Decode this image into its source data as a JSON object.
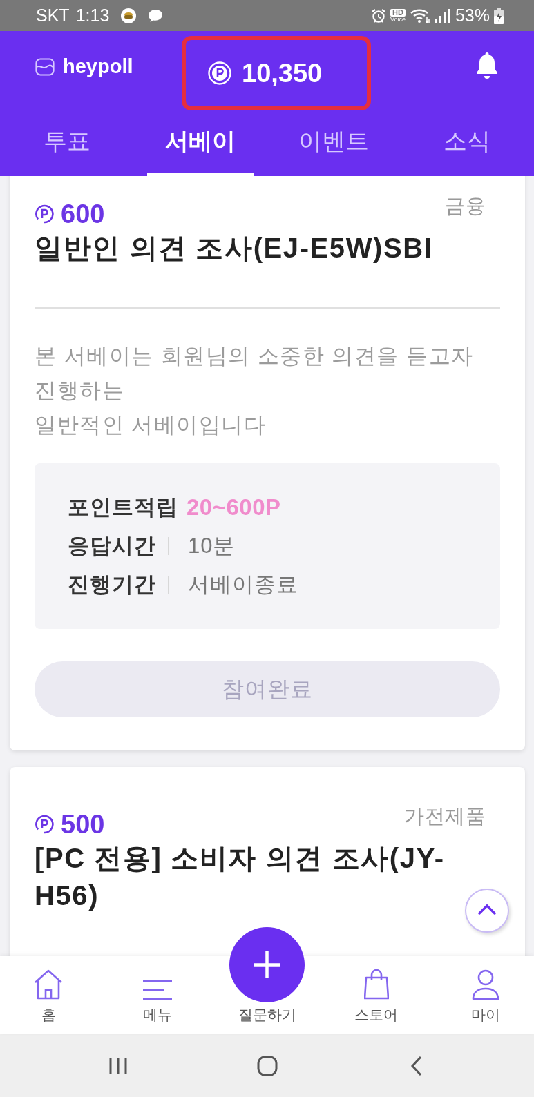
{
  "status_bar": {
    "carrier": "SKT",
    "time": "1:13",
    "call_badge": [
      "HD",
      "Voice"
    ],
    "battery": "53%"
  },
  "header": {
    "logo": "heypoll",
    "points": {
      "value": "10,350",
      "highlighted": true
    }
  },
  "tabs": [
    {
      "label": "투표",
      "selected": false
    },
    {
      "label": "서베이",
      "selected": true
    },
    {
      "label": "이벤트",
      "selected": false
    },
    {
      "label": "소식",
      "selected": false
    }
  ],
  "surveys": [
    {
      "points": "600",
      "category": "금융",
      "title": "일반인 의견 조사(EJ-E5W)SBI",
      "description": "본 서베이는 회원님의 소중한 의견을 듣고자 진행하는\n일반적인 서베이입니다",
      "details": [
        {
          "kind": "reward",
          "label": "포인트적립",
          "value": "20~600P"
        },
        {
          "kind": "plain",
          "label": "응답시간",
          "value": "10분"
        },
        {
          "kind": "plain",
          "label": "진행기간",
          "value": "서베이종료"
        }
      ],
      "button": {
        "label": "참여완료",
        "disabled": true
      }
    },
    {
      "points": "500",
      "category": "가전제품",
      "title": "[PC 전용] 소비자 의견 조사(JY-H56)"
    }
  ],
  "bottom_nav": [
    {
      "kind": "home",
      "label": "홈"
    },
    {
      "kind": "menu",
      "label": "메뉴"
    },
    {
      "kind": "ask",
      "label": "질문하기"
    },
    {
      "kind": "store",
      "label": "스토어"
    },
    {
      "kind": "my",
      "label": "마이"
    }
  ]
}
